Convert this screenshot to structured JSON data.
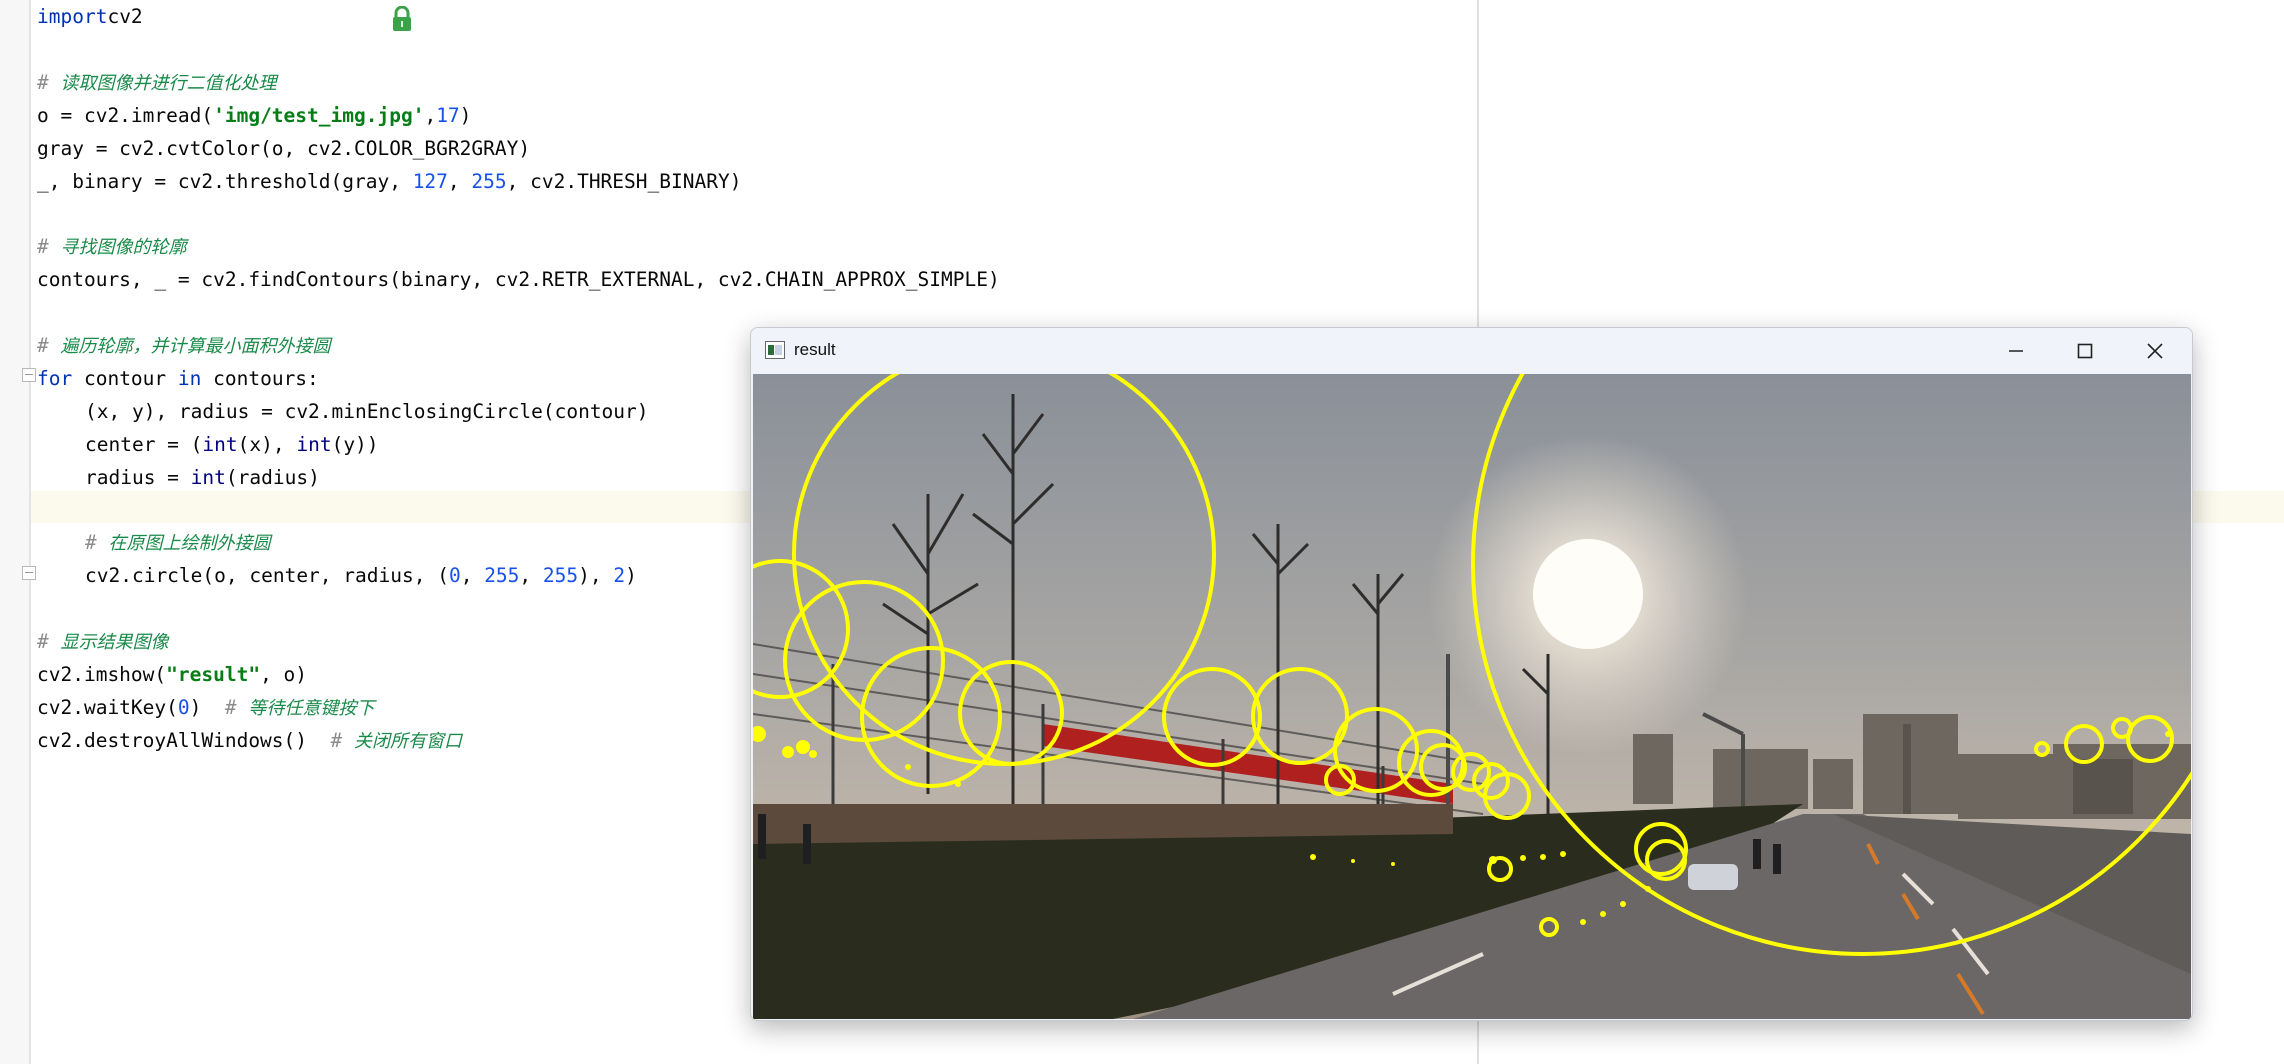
{
  "editor": {
    "lines": [
      {
        "indent": 0,
        "tokens": [
          [
            "kw",
            "import"
          ],
          [
            "",
            "cv2"
          ]
        ]
      },
      {
        "indent": 0,
        "tokens": []
      },
      {
        "indent": 0,
        "tokens": [
          [
            "cmt",
            "# "
          ],
          [
            "cmt-zh",
            "读取图像并进行二值化处理"
          ]
        ]
      },
      {
        "indent": 0,
        "tokens": [
          [
            "",
            "o = cv2.imread("
          ],
          [
            "str",
            "'img/test_img.jpg'"
          ],
          [
            "",
            ","
          ],
          [
            "num",
            "17"
          ],
          [
            "",
            ")"
          ]
        ]
      },
      {
        "indent": 0,
        "tokens": [
          [
            "",
            "gray = cv2.cvtColor(o, cv2.COLOR_BGR2GRAY)"
          ]
        ]
      },
      {
        "indent": 0,
        "tokens": [
          [
            "",
            "_, binary = cv2.threshold(gray, "
          ],
          [
            "num",
            "127"
          ],
          [
            "",
            ", "
          ],
          [
            "num",
            "255"
          ],
          [
            "",
            ", cv2.THRESH_BINARY)"
          ]
        ]
      },
      {
        "indent": 0,
        "tokens": []
      },
      {
        "indent": 0,
        "tokens": [
          [
            "cmt",
            "# "
          ],
          [
            "cmt-zh",
            "寻找图像的轮廓"
          ]
        ]
      },
      {
        "indent": 0,
        "tokens": [
          [
            "",
            "contours, _ = cv2.findContours(binary, cv2.RETR_EXTERNAL, cv2.CHAIN_APPROX_SIMPLE)"
          ]
        ]
      },
      {
        "indent": 0,
        "tokens": []
      },
      {
        "indent": 0,
        "tokens": [
          [
            "cmt",
            "# "
          ],
          [
            "cmt-zh",
            "遍历轮廓，并计算最小面积外接圆"
          ]
        ]
      },
      {
        "indent": 0,
        "tokens": [
          [
            "kw",
            "for"
          ],
          [
            "",
            " contour "
          ],
          [
            "kw",
            "in"
          ],
          [
            "",
            " contours:"
          ]
        ]
      },
      {
        "indent": 1,
        "tokens": [
          [
            "",
            "(x, y), radius = cv2.minEnclosingCircle(contour)"
          ]
        ]
      },
      {
        "indent": 1,
        "tokens": [
          [
            "",
            "center = ("
          ],
          [
            "fn",
            "int"
          ],
          [
            "",
            "(x), "
          ],
          [
            "fn",
            "int"
          ],
          [
            "",
            "(y))"
          ]
        ]
      },
      {
        "indent": 1,
        "tokens": [
          [
            "",
            "radius = "
          ],
          [
            "fn",
            "int"
          ],
          [
            "",
            "(radius)"
          ]
        ]
      },
      {
        "indent": 0,
        "tokens": []
      },
      {
        "indent": 1,
        "tokens": [
          [
            "cmt",
            "# "
          ],
          [
            "cmt-zh",
            "在原图上绘制外接圆"
          ]
        ]
      },
      {
        "indent": 1,
        "tokens": [
          [
            "",
            "cv2.circle(o, center, radius, ("
          ],
          [
            "num",
            "0"
          ],
          [
            "",
            ", "
          ],
          [
            "num",
            "255"
          ],
          [
            "",
            ", "
          ],
          [
            "num",
            "255"
          ],
          [
            "",
            "), "
          ],
          [
            "num",
            "2"
          ],
          [
            "",
            ")"
          ]
        ]
      },
      {
        "indent": 0,
        "tokens": []
      },
      {
        "indent": 0,
        "tokens": [
          [
            "cmt",
            "# "
          ],
          [
            "cmt-zh",
            "显示结果图像"
          ]
        ]
      },
      {
        "indent": 0,
        "tokens": [
          [
            "",
            "cv2.imshow("
          ],
          [
            "str",
            "\"result\""
          ],
          [
            "",
            ", o)"
          ]
        ]
      },
      {
        "indent": 0,
        "tokens": [
          [
            "",
            "cv2.waitKey("
          ],
          [
            "num",
            "0"
          ],
          [
            "",
            ")  "
          ],
          [
            "cmt",
            "# "
          ],
          [
            "cmt-zh",
            "等待任意键按下"
          ]
        ]
      },
      {
        "indent": 0,
        "tokens": [
          [
            "",
            "cv2.destroyAllWindows()  "
          ],
          [
            "cmt",
            "# "
          ],
          [
            "cmt-zh",
            "关闭所有窗口"
          ]
        ]
      }
    ]
  },
  "result_window": {
    "title": "result",
    "controls": [
      "minimize-icon",
      "maximize-icon",
      "close-icon"
    ],
    "circle_color": "#ffff00"
  },
  "colors": {
    "keyword": "#0033b3",
    "string": "#067d17",
    "number": "#1750eb",
    "comment": "#1a8a4a"
  }
}
